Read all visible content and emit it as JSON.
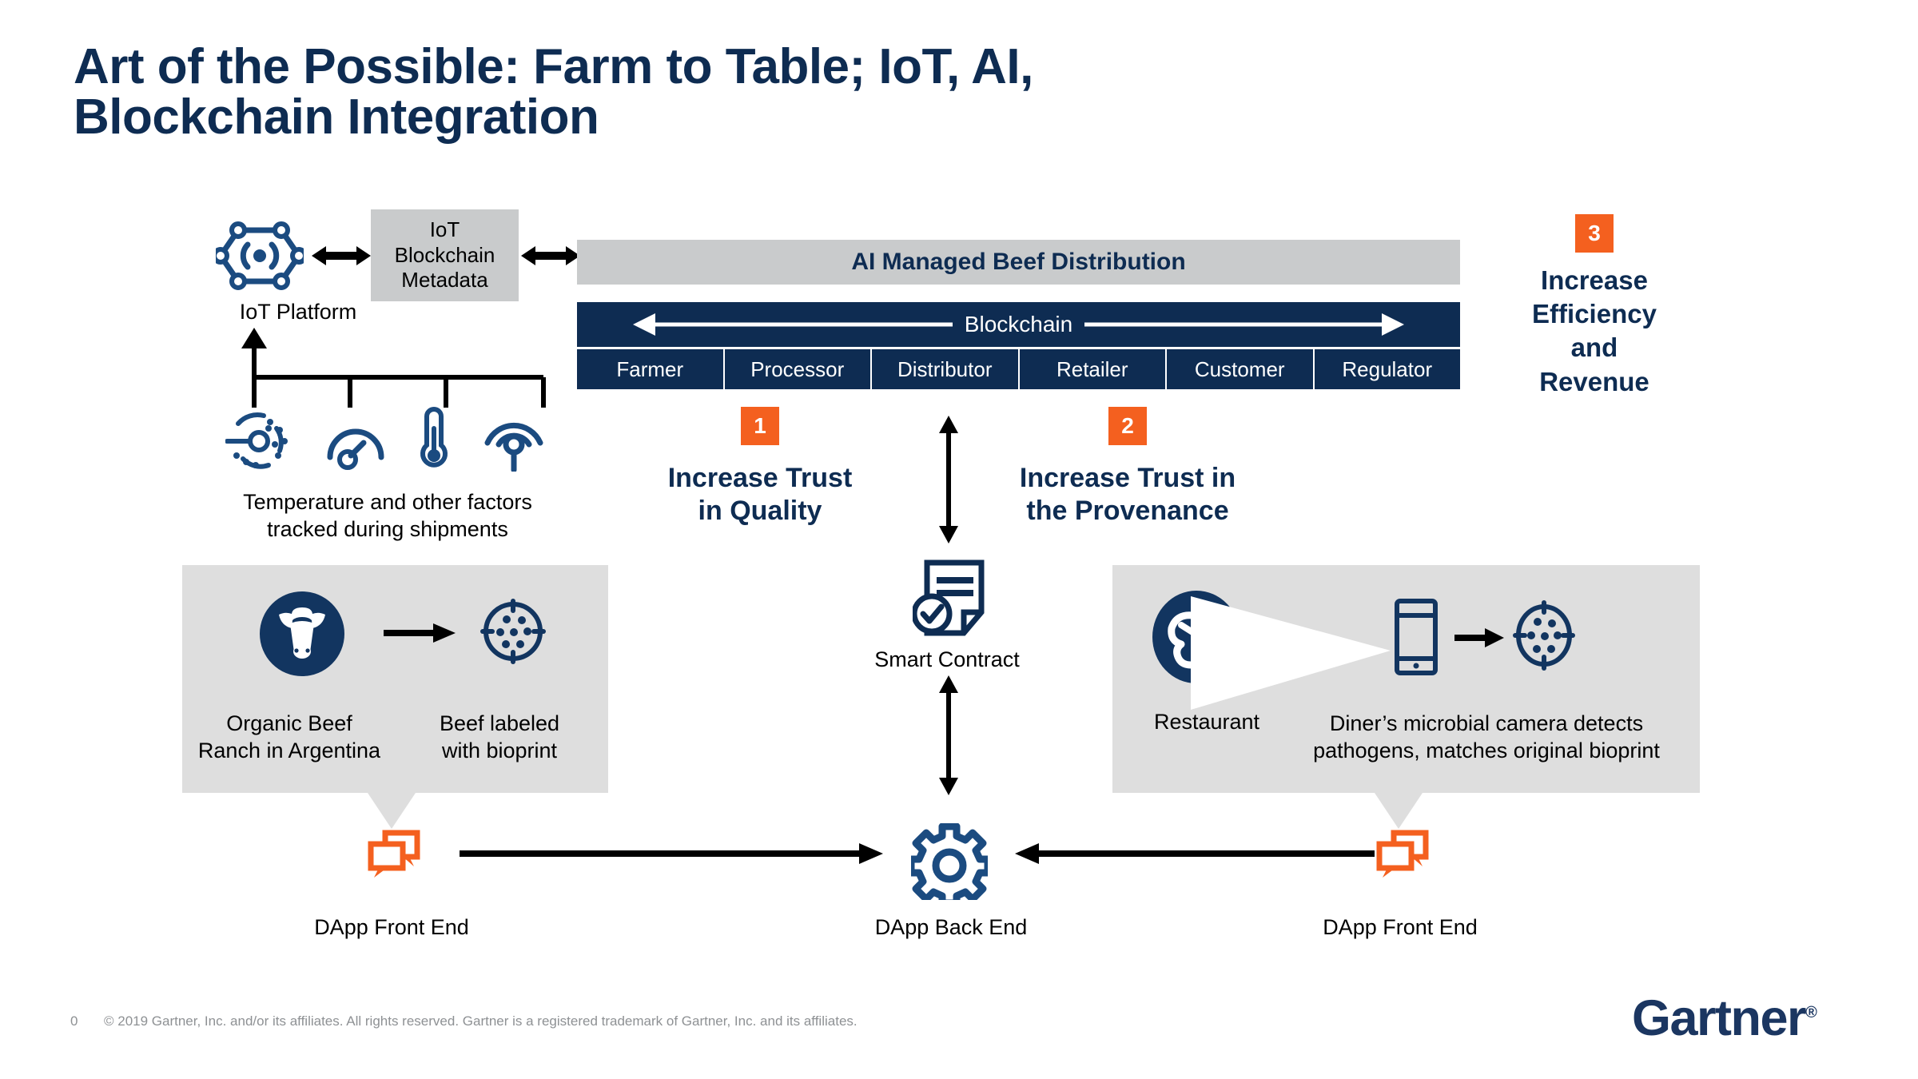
{
  "title": {
    "line1": "Art of the Possible: Farm to Table; IoT, AI,",
    "line2": "Blockchain Integration"
  },
  "colors": {
    "navy": "#0E2C52",
    "orange": "#F4601F",
    "gray_bar": "#C9CBCC",
    "gray_panel": "#DEDEDE",
    "white": "#FFFFFF"
  },
  "iot": {
    "platform_label": "IoT Platform",
    "platform_icon": "iot-hexagon-node-icon",
    "metadata_box": "IoT\nBlockchain\nMetadata",
    "metadata_line1": "IoT",
    "metadata_line2": "Blockchain",
    "metadata_line3": "Metadata",
    "arrow_1": "double-arrow-icon",
    "arrow_2": "double-arrow-icon",
    "sensors": [
      {
        "name": "radar-sensor-icon"
      },
      {
        "name": "gauge-icon"
      },
      {
        "name": "thermometer-icon"
      },
      {
        "name": "wireless-signal-icon"
      }
    ],
    "sensors_caption_line1": "Temperature and other factors",
    "sensors_caption_line2": "tracked during shipments"
  },
  "distribution": {
    "ai_bar_label": "AI Managed Beef Distribution",
    "blockchain_label": "Blockchain",
    "roles": [
      "Farmer",
      "Processor",
      "Distributor",
      "Retailer",
      "Customer",
      "Regulator"
    ]
  },
  "callouts": [
    {
      "badge": "1",
      "line1": "Increase Trust",
      "line2": "in Quality"
    },
    {
      "badge": "2",
      "line1": "Increase Trust in",
      "line2": "the Provenance"
    },
    {
      "badge": "3",
      "line1": "Increase",
      "line2": "Efficiency",
      "line3": "and",
      "line4": "Revenue"
    }
  ],
  "smart_contract": {
    "label": "Smart Contract",
    "icon": "contract-document-check-icon"
  },
  "left_panel": {
    "source_icon": "cow-head-icon",
    "arrow_icon": "right-arrow-icon",
    "result_icon": "bioprint-icon",
    "caption_1_line1": "Organic Beef",
    "caption_1_line2": "Ranch in Argentina",
    "caption_2_line1": "Beef labeled",
    "caption_2_line2": "with bioprint"
  },
  "right_panel": {
    "restaurant_icon": "steak-icon",
    "phone_icon": "smartphone-icon",
    "arrow_icon": "right-arrow-icon",
    "result_icon": "bioprint-icon",
    "caption_1": "Restaurant",
    "caption_2_line1": "Diner’s microbial camera detects",
    "caption_2_line2": "pathogens, matches original bioprint"
  },
  "dapp": {
    "front_end_left_label": "DApp Front End",
    "back_end_label": "DApp Back End",
    "front_end_right_label": "DApp Front End",
    "front_end_icon": "chat-bubbles-icon",
    "back_end_icon": "gear-icon",
    "arrow_left_icon": "right-arrow-icon",
    "arrow_right_icon": "left-arrow-icon"
  },
  "footer": {
    "page_number": "0",
    "copyright": "© 2019 Gartner, Inc. and/or its affiliates. All rights reserved. Gartner is a registered trademark of Gartner, Inc. and its affiliates.",
    "logo_text": "Gartner",
    "logo_mark": "®"
  }
}
